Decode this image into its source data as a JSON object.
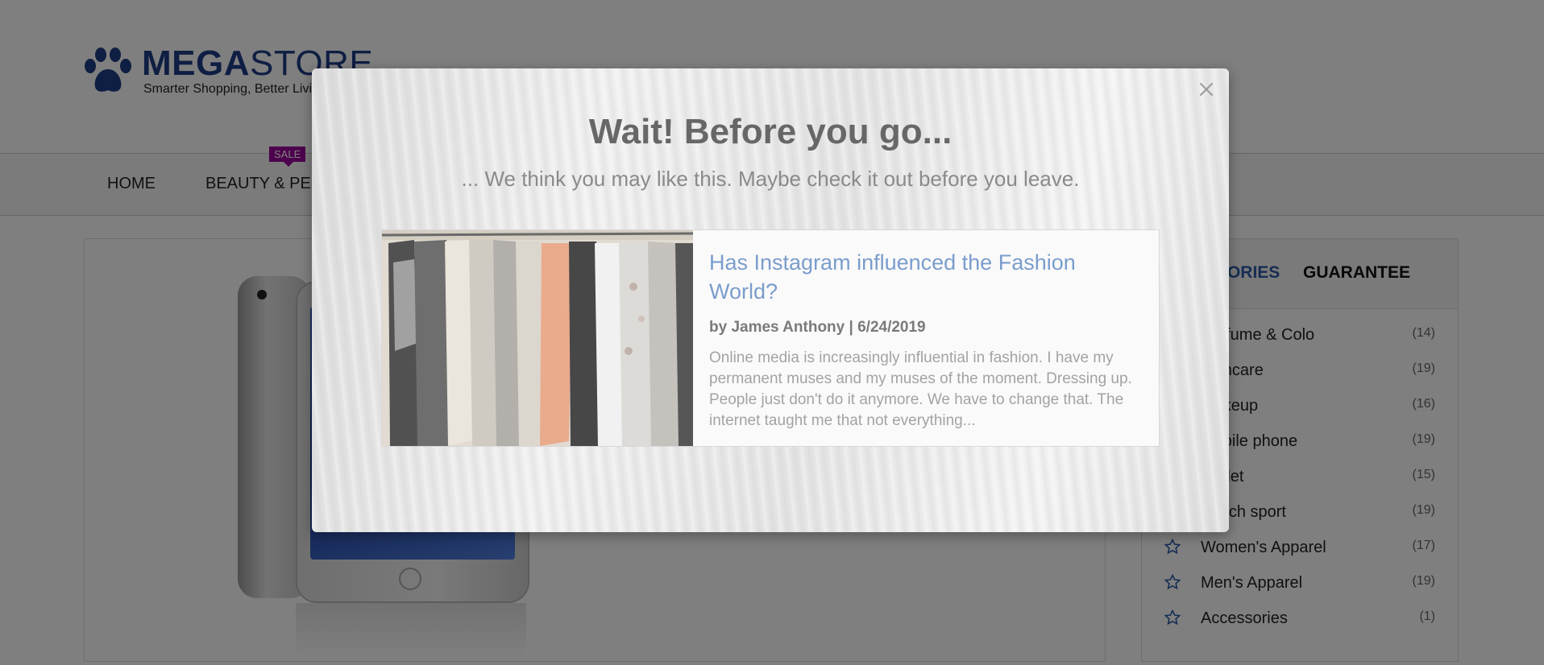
{
  "logo": {
    "brand_bold": "MEGA",
    "brand_light": "STORE",
    "tagline": "Smarter Shopping, Better Living"
  },
  "nav": {
    "items": [
      "HOME",
      "BEAUTY & PERFUME"
    ],
    "sale_badge": "SALE"
  },
  "sidebar": {
    "tabs": [
      "CATEGORIES",
      "GUARANTEE"
    ],
    "categories": [
      {
        "name": "Perfume & Colo",
        "count": "(14)"
      },
      {
        "name": "Skincare",
        "count": "(19)"
      },
      {
        "name": "Makeup",
        "count": "(16)"
      },
      {
        "name": "Mobile phone",
        "count": "(19)"
      },
      {
        "name": "Tablet",
        "count": "(15)"
      },
      {
        "name": "Watch sport",
        "count": "(19)"
      },
      {
        "name": "Women's Apparel",
        "count": "(17)"
      },
      {
        "name": "Men's Apparel",
        "count": "(19)"
      },
      {
        "name": "Accessories",
        "count": "(1)"
      }
    ]
  },
  "modal": {
    "title": "Wait! Before you go...",
    "subtitle": "... We think you may like this. Maybe check it out before you leave.",
    "card": {
      "title": "Has Instagram influenced the Fashion World?",
      "meta": "by James Anthony | 6/24/2019",
      "excerpt": "Online media is increasingly influential in fashion. I have my permanent muses and my muses of the moment. Dressing up. People just don't do it anymore. We have to change that. The internet taught me that not everything..."
    }
  },
  "colors": {
    "brand": "#1f3c86",
    "sale": "#9b009b",
    "link": "#7a9dcc",
    "overlay": "rgba(0,0,0,0.5)"
  },
  "icons": {
    "close": "close-icon",
    "star": "star-outline-icon",
    "logo": "paw-icon"
  }
}
